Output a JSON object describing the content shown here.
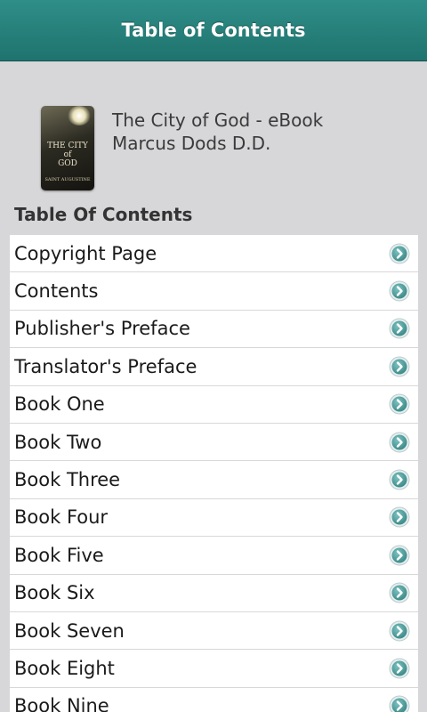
{
  "header": {
    "title": "Table of Contents"
  },
  "book": {
    "title": "The City of God - eBook",
    "author": "Marcus Dods D.D.",
    "cover": {
      "title_line1": "THE CITY",
      "title_line2": "of",
      "title_line3": "GOD",
      "author": "SAINT AUGUSTINE"
    }
  },
  "section_heading": "Table Of Contents",
  "toc": {
    "items": [
      {
        "label": "Copyright Page"
      },
      {
        "label": "Contents"
      },
      {
        "label": "Publisher's Preface"
      },
      {
        "label": "Translator's Preface"
      },
      {
        "label": "Book One"
      },
      {
        "label": "Book Two"
      },
      {
        "label": "Book Three"
      },
      {
        "label": "Book Four"
      },
      {
        "label": "Book Five"
      },
      {
        "label": "Book Six"
      },
      {
        "label": "Book Seven"
      },
      {
        "label": "Book Eight"
      },
      {
        "label": "Book Nine"
      }
    ],
    "row_icon": "chevron-right-circle-icon"
  },
  "colors": {
    "header": "#2a8580",
    "background": "#d7d6d9",
    "icon": "#3d8b8a"
  }
}
